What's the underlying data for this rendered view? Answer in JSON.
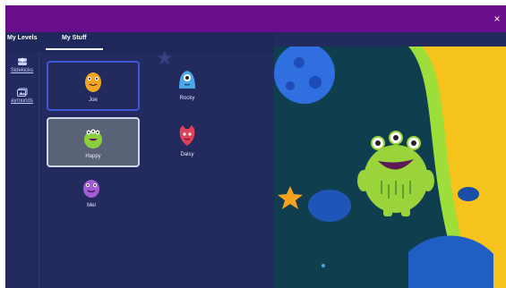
{
  "window": {
    "close_glyph": "×"
  },
  "tabs": [
    {
      "label": "My Levels"
    },
    {
      "label": "My Stuff"
    }
  ],
  "sidebar": {
    "items": [
      {
        "label": "Sidekicks",
        "icon": "sidekicks-icon"
      },
      {
        "label": "ayrounds",
        "icon": "playgrounds-icon"
      }
    ]
  },
  "characters": [
    {
      "name": "Joe",
      "color": "#f2a623"
    },
    {
      "name": "Rocky",
      "color": "#4aa7e8"
    },
    {
      "name": "Happy",
      "color": "#8ccf3e"
    },
    {
      "name": "Daisy",
      "color": "#e0415a"
    },
    {
      "name": "Mel",
      "color": "#a35cd6"
    }
  ],
  "colors": {
    "topbar": "#6a0d8c",
    "panel": "#232a5e",
    "selected_border": "#3c55d9",
    "planet": "#f6c21c",
    "monster": "#9bd33b"
  }
}
